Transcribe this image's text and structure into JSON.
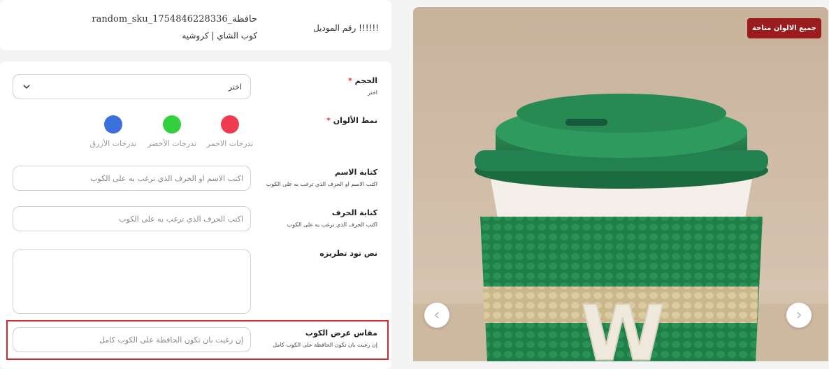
{
  "header": {
    "model_label": "!!!!!! رقم الموديل",
    "sku": "حافظة_random_sku_1754846228336",
    "product_name": "كوب الشاي | كروشيه"
  },
  "fields": {
    "size": {
      "label": "الحجم",
      "required_mark": "*",
      "hint": "اختر",
      "value": "اختر"
    },
    "color_pattern": {
      "label": "نمط الألوان",
      "required_mark": "*",
      "options": [
        {
          "name": "تدرجات الاحمر",
          "color": "#ef3b4f"
        },
        {
          "name": "تدرجات الأخضر",
          "color": "#34d13e"
        },
        {
          "name": "تدرجات الأزرق",
          "color": "#3a6fdd"
        }
      ]
    },
    "name_writing": {
      "label": "كتابة الاسم",
      "hint": "اكتب الاسم او الحرف الذي ترغب به على الكوب",
      "placeholder": "اكتب الاسم او الحرف الذي ترغب به على الكوب"
    },
    "letter_writing": {
      "label": "كتابة الحرف",
      "hint": "اكتب الحرف الذي ترغب به على الكوب",
      "placeholder": "اكتب الحرف الذي ترغب به على الكوب"
    },
    "embroidery_text": {
      "label": "نص تود تطريزه",
      "value": ""
    },
    "cup_width": {
      "label": "مقاس عرض الكوب",
      "hint": "إن رغبت بان تكون الحافظة على الكوب كامل",
      "placeholder": "إن رغبت بان تكون الحافظة على الكوب كامل"
    }
  },
  "gallery": {
    "badge": "جميع الالوان متاحة",
    "image_letter": "W",
    "prev_icon": "chevron-left-icon",
    "next_icon": "chevron-right-icon"
  },
  "colors": {
    "required": "#e53935",
    "badge_bg": "#9b1c1c",
    "highlight_border": "#d8262a"
  }
}
